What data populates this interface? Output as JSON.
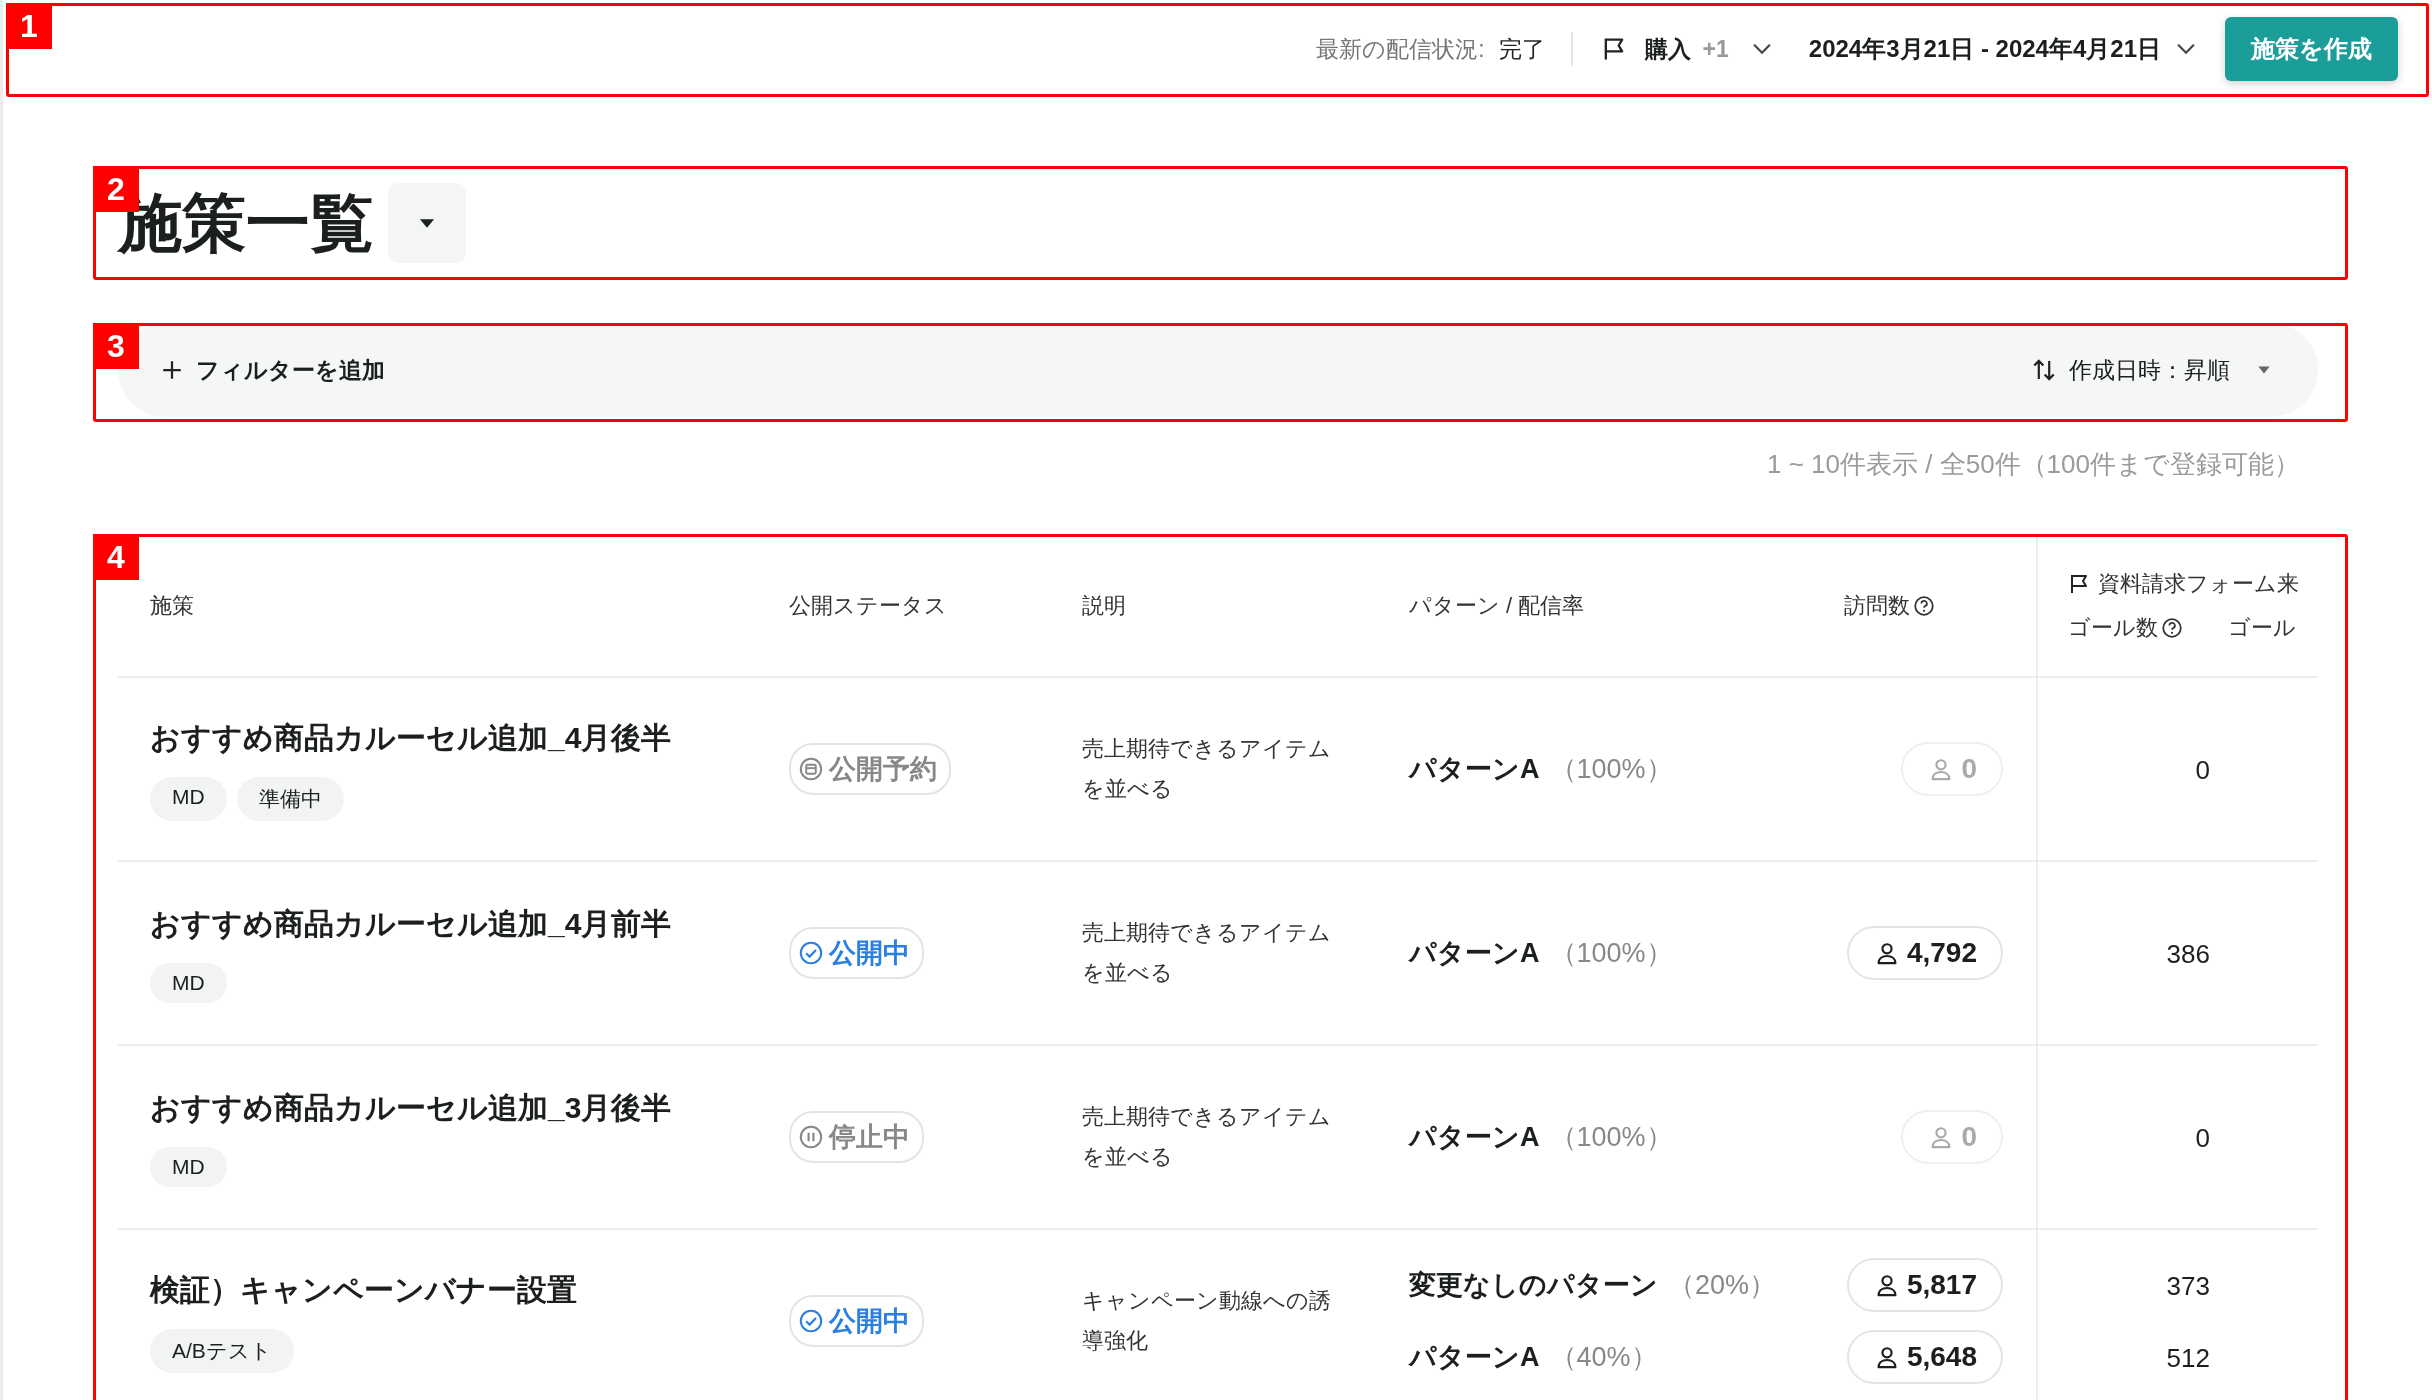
{
  "top_bar": {
    "annotation": "1",
    "delivery_status": {
      "label": "最新の配信状況:",
      "value": "完了"
    },
    "goal_filter": {
      "label": "購入",
      "extra": "+1"
    },
    "date_range": "2024年3月21日 - 2024年4月21日",
    "create_button": "施策を作成"
  },
  "heading": {
    "annotation": "2",
    "title": "施策一覧"
  },
  "filter_bar": {
    "annotation": "3",
    "add_filter": "フィルターを追加",
    "sort": "作成日時：昇順"
  },
  "count_text": "1 ~ 10件表示 / 全50件（100件まで登録可能）",
  "table": {
    "annotation": "4",
    "columns": [
      "施策",
      "公開ステータス",
      "説明",
      "パターン / 配信率",
      "訪問数"
    ],
    "goal_group": {
      "title": "資料請求フォーム来",
      "columns": [
        "ゴール数",
        "ゴール"
      ]
    },
    "rows": [
      {
        "title": "おすすめ商品カルーセル追加_4月後半",
        "tags": [
          "MD",
          "準備中"
        ],
        "status": {
          "kind": "scheduled",
          "label": "公開予約"
        },
        "description": "売上期待できるアイテムを並べる",
        "patterns": [
          {
            "name": "パターンA",
            "rate": "（100%）",
            "visits": "0",
            "empty": true,
            "goals": "0"
          }
        ]
      },
      {
        "title": "おすすめ商品カルーセル追加_4月前半",
        "tags": [
          "MD"
        ],
        "status": {
          "kind": "live",
          "label": "公開中"
        },
        "description": "売上期待できるアイテムを並べる",
        "patterns": [
          {
            "name": "パターンA",
            "rate": "（100%）",
            "visits": "4,792",
            "empty": false,
            "goals": "386"
          }
        ]
      },
      {
        "title": "おすすめ商品カルーセル追加_3月後半",
        "tags": [
          "MD"
        ],
        "status": {
          "kind": "stopped",
          "label": "停止中"
        },
        "description": "売上期待できるアイテムを並べる",
        "patterns": [
          {
            "name": "パターンA",
            "rate": "（100%）",
            "visits": "0",
            "empty": true,
            "goals": "0"
          }
        ]
      },
      {
        "title": "検証）キャンペーンバナー設置",
        "tags": [
          "A/Bテスト"
        ],
        "status": {
          "kind": "live",
          "label": "公開中"
        },
        "description": "キャンペーン動線への誘導強化",
        "patterns": [
          {
            "name": "変更なしのパターン",
            "rate": "（20%）",
            "visits": "5,817",
            "empty": false,
            "goals": "373"
          },
          {
            "name": "パターンA",
            "rate": "（40%）",
            "visits": "5,648",
            "empty": false,
            "goals": "512"
          }
        ]
      }
    ]
  }
}
